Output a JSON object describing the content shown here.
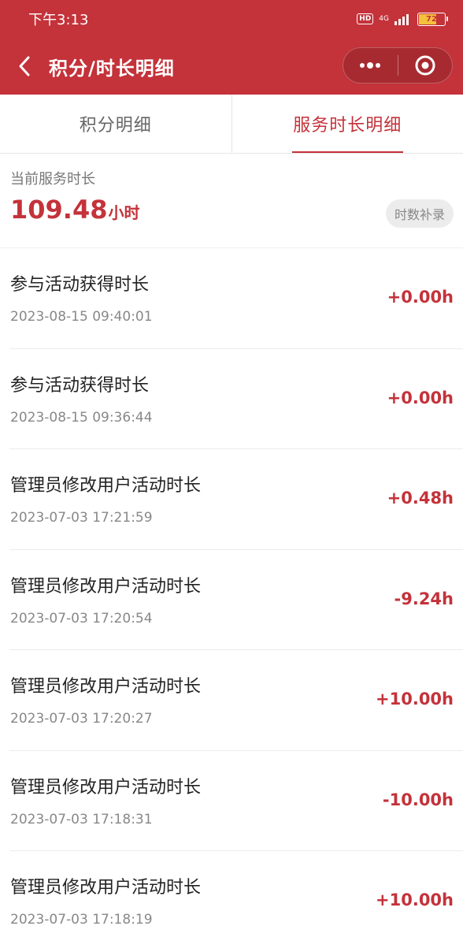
{
  "status_bar": {
    "time": "下午3:13",
    "hd": "HD",
    "network": "4G",
    "battery": "72",
    "battery_level": 0.72
  },
  "navbar": {
    "title": "积分/时长明细",
    "back_icon": "chevron-left-icon",
    "more_icon": "more-dots-icon",
    "close_icon": "target-circle-icon"
  },
  "tabs": [
    {
      "label": "积分明细",
      "active": false
    },
    {
      "label": "服务时长明细",
      "active": true
    }
  ],
  "summary": {
    "label": "当前服务时长",
    "value": "109.48",
    "unit": "小时",
    "supplement_button": "时数补录"
  },
  "records": [
    {
      "title": "参与活动获得时长",
      "time": "2023-08-15 09:40:01",
      "amount": "+0.00h"
    },
    {
      "title": "参与活动获得时长",
      "time": "2023-08-15 09:36:44",
      "amount": "+0.00h"
    },
    {
      "title": "管理员修改用户活动时长",
      "time": "2023-07-03 17:21:59",
      "amount": "+0.48h"
    },
    {
      "title": "管理员修改用户活动时长",
      "time": "2023-07-03 17:20:54",
      "amount": "-9.24h"
    },
    {
      "title": "管理员修改用户活动时长",
      "time": "2023-07-03 17:20:27",
      "amount": "+10.00h"
    },
    {
      "title": "管理员修改用户活动时长",
      "time": "2023-07-03 17:18:31",
      "amount": "-10.00h"
    },
    {
      "title": "管理员修改用户活动时长",
      "time": "2023-07-03 17:18:19",
      "amount": "+10.00h"
    }
  ],
  "colors": {
    "brand": "#c4323a",
    "muted_text": "#888888",
    "divider": "#ececec"
  }
}
